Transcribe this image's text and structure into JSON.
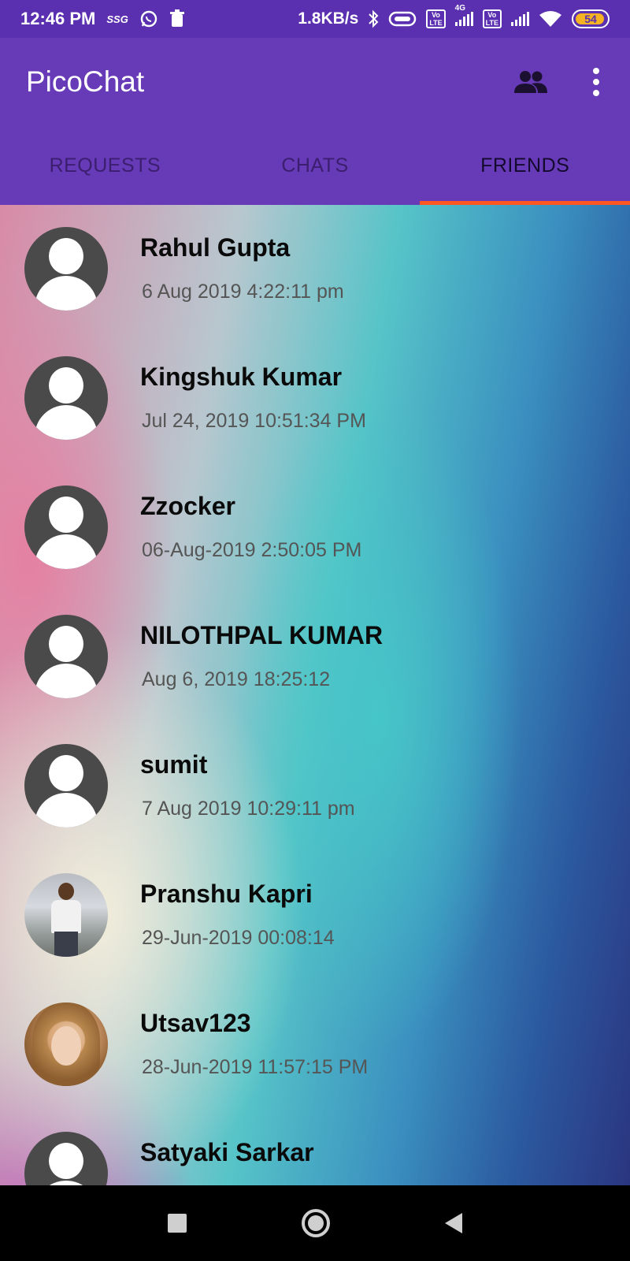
{
  "status_bar": {
    "time": "12:46 PM",
    "carrier_tag": "SSG",
    "net_speed": "1.8KB/s",
    "network_type": "4G",
    "volte_label": "Vo LTE",
    "battery_level": "54"
  },
  "app_bar": {
    "title": "PicoChat"
  },
  "tabs": [
    {
      "label": "REQUESTS",
      "active": false
    },
    {
      "label": "CHATS",
      "active": false
    },
    {
      "label": "FRIENDS",
      "active": true
    }
  ],
  "friends": [
    {
      "name": "Rahul Gupta",
      "time": "6 Aug 2019 4:22:11 pm",
      "avatar": "default-avatar"
    },
    {
      "name": "Kingshuk Kumar",
      "time": "Jul 24, 2019 10:51:34 PM",
      "avatar": "default-avatar"
    },
    {
      "name": "Zzocker",
      "time": "06-Aug-2019 2:50:05 PM",
      "avatar": "default-avatar"
    },
    {
      "name": "NILOTHPAL KUMAR",
      "time": "Aug 6, 2019 18:25:12",
      "avatar": "default-avatar"
    },
    {
      "name": "sumit",
      "time": "7 Aug 2019 10:29:11 pm",
      "avatar": "default-avatar"
    },
    {
      "name": "Pranshu Kapri",
      "time": "29-Jun-2019 00:08:14",
      "avatar": "photo-man"
    },
    {
      "name": "Utsav123",
      "time": "28-Jun-2019 11:57:15 PM",
      "avatar": "photo-woman"
    },
    {
      "name": "Satyaki Sarkar",
      "time": "",
      "avatar": "default-avatar"
    }
  ],
  "colors": {
    "status_bar": "#5a2fb0",
    "app_bar": "#673ab7",
    "tab_indicator": "#ff5722"
  }
}
